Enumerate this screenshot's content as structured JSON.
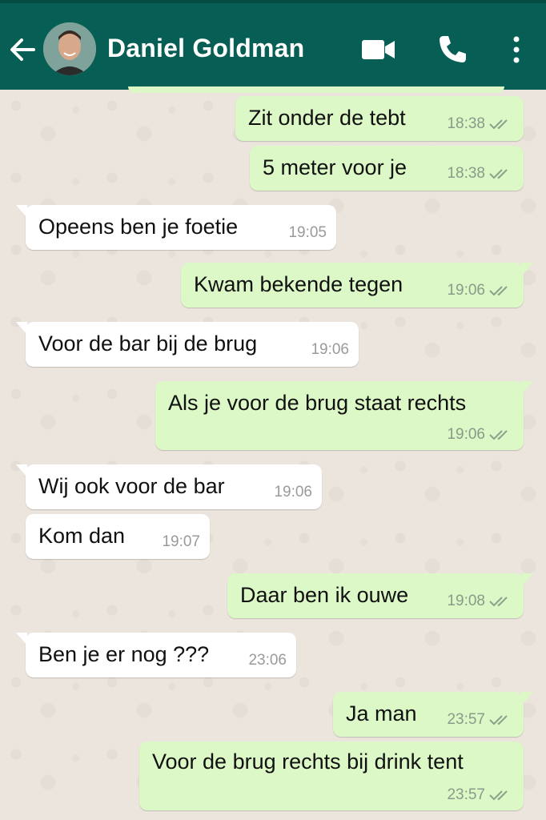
{
  "header": {
    "contact_name": "Daniel Goldman",
    "bar_color": "#075e54",
    "icons": [
      "back-arrow-icon",
      "avatar",
      "video-call-icon",
      "phone-call-icon",
      "more-options-icon"
    ]
  },
  "messages": [
    {
      "dir": "out",
      "text": "Zit onder de tebt",
      "time": "18:38",
      "read": true
    },
    {
      "dir": "out",
      "text": "5 meter voor je",
      "time": "18:38",
      "read": true
    },
    {
      "dir": "in",
      "text": "Opeens ben je foetie",
      "time": "19:05"
    },
    {
      "dir": "out",
      "text": "Kwam bekende tegen",
      "time": "19:06",
      "read": true
    },
    {
      "dir": "in",
      "text": "Voor de bar bij de brug",
      "time": "19:06"
    },
    {
      "dir": "out",
      "text": "Als je voor de brug staat rechts",
      "time": "19:06",
      "read": true
    },
    {
      "dir": "in",
      "text": "Wij ook voor de bar",
      "time": "19:06"
    },
    {
      "dir": "in",
      "text": "Kom dan",
      "time": "19:07"
    },
    {
      "dir": "out",
      "text": "Daar ben ik ouwe",
      "time": "19:08",
      "read": true
    },
    {
      "dir": "in",
      "text": "Ben je er nog ???",
      "time": "23:06"
    },
    {
      "dir": "out",
      "text": "Ja man",
      "time": "23:57",
      "read": true
    },
    {
      "dir": "out",
      "text": "Voor de brug rechts bij drink tent",
      "time": "23:57",
      "read": true
    }
  ],
  "colors": {
    "outgoing_bubble": "#dcf8c6",
    "incoming_bubble": "#ffffff",
    "wallpaper": "#ece5dd"
  }
}
